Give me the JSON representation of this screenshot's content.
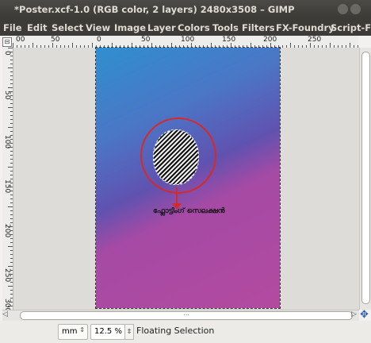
{
  "window": {
    "title": "*Poster.xcf-1.0 (RGB color, 2 layers) 2480x3508 – GIMP"
  },
  "menu": [
    "File",
    "Edit",
    "Select",
    "View",
    "Image",
    "Layer",
    "Colors",
    "Tools",
    "Filters",
    "FX-Foundry",
    "Script-Fu"
  ],
  "ruler": {
    "horizontal_labels": [
      "00",
      "50",
      "0",
      "50",
      "100",
      "150",
      "200",
      "250"
    ],
    "vertical_labels": [
      "0",
      "50",
      "100",
      "150",
      "200",
      "250",
      "300"
    ]
  },
  "canvas": {
    "caption": "ഫ്ലോട്ടിംഗ് സെലക്ഷൻ"
  },
  "statusbar": {
    "unit": "mm",
    "zoom": "12.5 %",
    "message": "Floating Selection"
  },
  "colors": {
    "gradient_top": "#2f8fd0",
    "gradient_bottom": "#b34aa0",
    "annotation_red": "#d52a2a"
  }
}
